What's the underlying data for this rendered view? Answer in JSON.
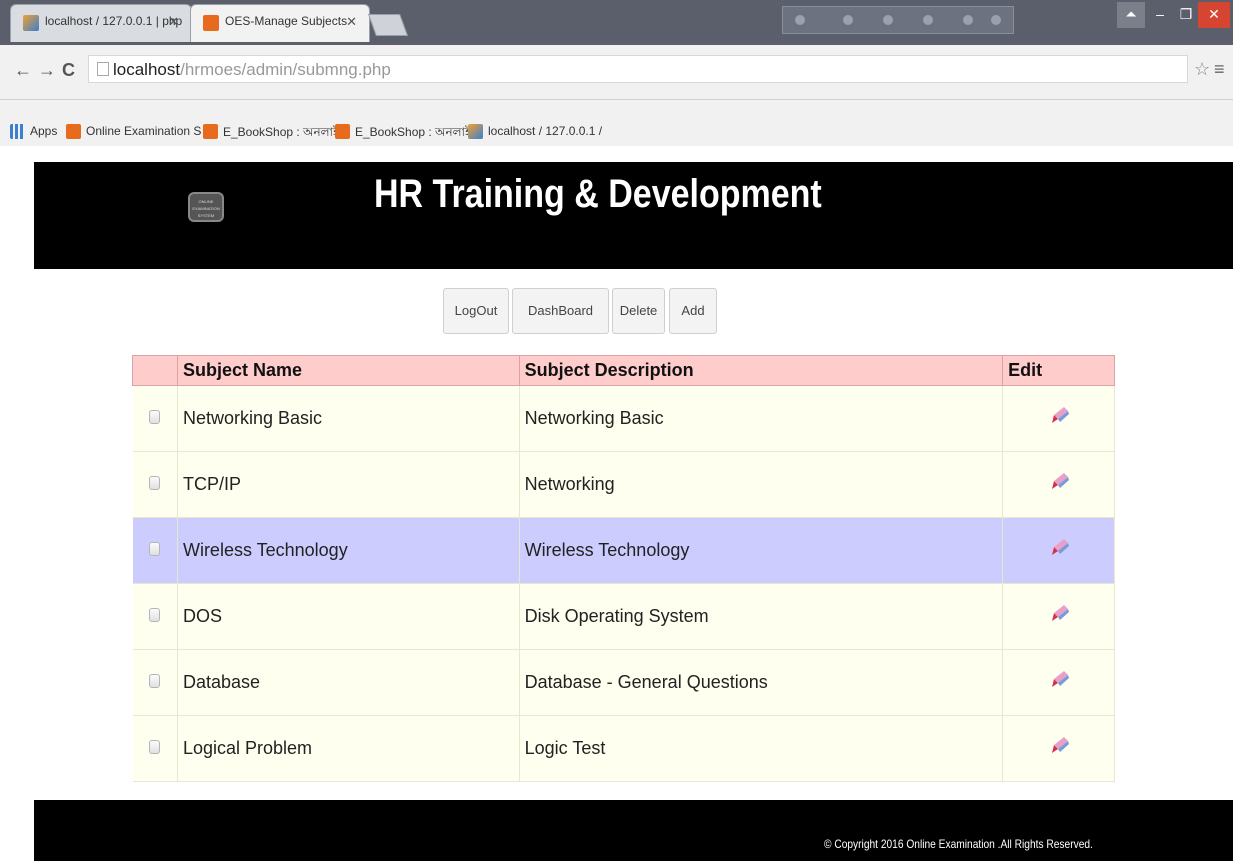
{
  "browser": {
    "tabs": [
      {
        "label": "localhost / 127.0.0.1 | php",
        "close": "✕"
      },
      {
        "label": "OES-Manage Subjects",
        "close": "✕"
      }
    ],
    "window_controls": {
      "minimize": "–",
      "maximize": "❐",
      "close": "✕"
    },
    "address": {
      "host": "localhost",
      "path": "/hrmoes/admin/submng.php"
    },
    "bookmarks": [
      {
        "label": "Apps",
        "icon": "apps-grid-icon"
      },
      {
        "label": "Online Examination S",
        "icon": "orange-page-icon"
      },
      {
        "label": "E_BookShop : অনলাইন",
        "icon": "orange-page-icon"
      },
      {
        "label": "E_BookShop : অনলাইন",
        "icon": "orange-page-icon"
      },
      {
        "label": "localhost / 127.0.0.1 /",
        "icon": "phpmyadmin-icon"
      }
    ]
  },
  "header": {
    "logo_text": "ONLINE EXAMINATION SYSTEM",
    "title": "HR Training & Development"
  },
  "actions": {
    "logout": "LogOut",
    "dashboard": "DashBoard",
    "delete": "Delete",
    "add": "Add"
  },
  "table": {
    "columns": [
      "",
      "Subject Name",
      "Subject Description",
      "Edit"
    ],
    "rows": [
      {
        "name": "Networking Basic",
        "description": "Networking Basic"
      },
      {
        "name": "TCP/IP",
        "description": "Networking"
      },
      {
        "name": "Wireless Technology",
        "description": "Wireless Technology"
      },
      {
        "name": "DOS",
        "description": "Disk Operating System"
      },
      {
        "name": "Database",
        "description": "Database - General Questions"
      },
      {
        "name": "Logical Problem",
        "description": "Logic Test"
      }
    ],
    "highlighted_row": 2
  },
  "footer": {
    "copyright": "© Copyright 2016 Online Examination .All Rights Reserved."
  },
  "colors": {
    "header_bg": "#000000",
    "table_header_bg": "#ffcccc",
    "row_bg": "#fffff0",
    "row_highlight_bg": "#ccccff"
  }
}
